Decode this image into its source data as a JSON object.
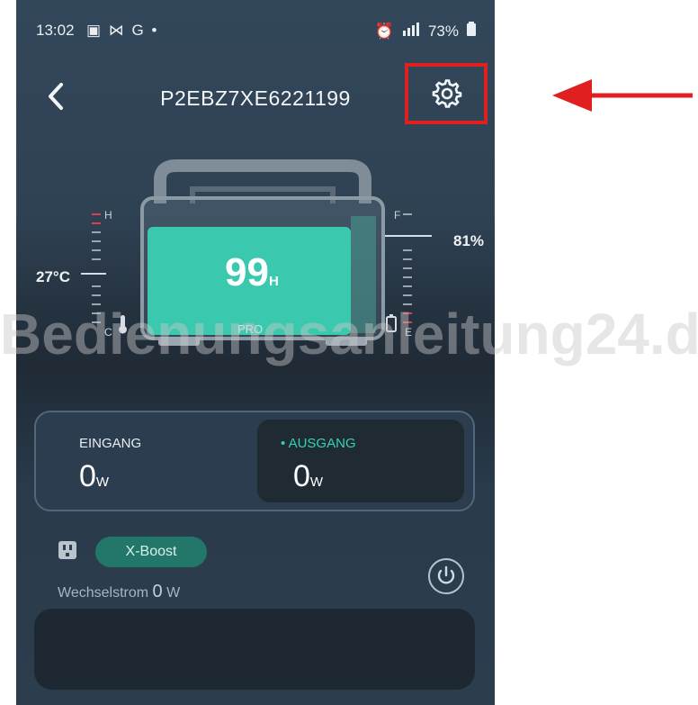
{
  "status_bar": {
    "time": "13:02",
    "left_icons": "▣ ⋈ G •",
    "battery_pct": "73%"
  },
  "header": {
    "title": "P2EBZ7XE6221199",
    "back_icon": "chevron-left-icon",
    "settings_icon": "gear-icon",
    "highlight_color": "#e02020"
  },
  "device": {
    "remaining_time": "99",
    "remaining_unit": "H",
    "model_badge": "PRO",
    "temperature": "27°C",
    "temp_high_label": "H",
    "temp_low_label": "C",
    "charge_pct": "81%",
    "charge_full_label": "F",
    "charge_empty_label": "E",
    "charge_level": 0.81,
    "fill_color": "#3ac9ae"
  },
  "io": {
    "input_label": "EINGANG",
    "input_value": "0",
    "input_unit": "W",
    "output_label": "• AUSGANG",
    "output_value": "0",
    "output_unit": "W",
    "output_label_color": "#35d1b3"
  },
  "ac": {
    "boost_label": "X-Boost",
    "ac_label": "Wechselstrom",
    "ac_value": "0",
    "ac_unit": "W"
  },
  "watermark": "Bedienungsanleitung24.de",
  "annotation": {
    "arrow_color": "#e02020"
  }
}
